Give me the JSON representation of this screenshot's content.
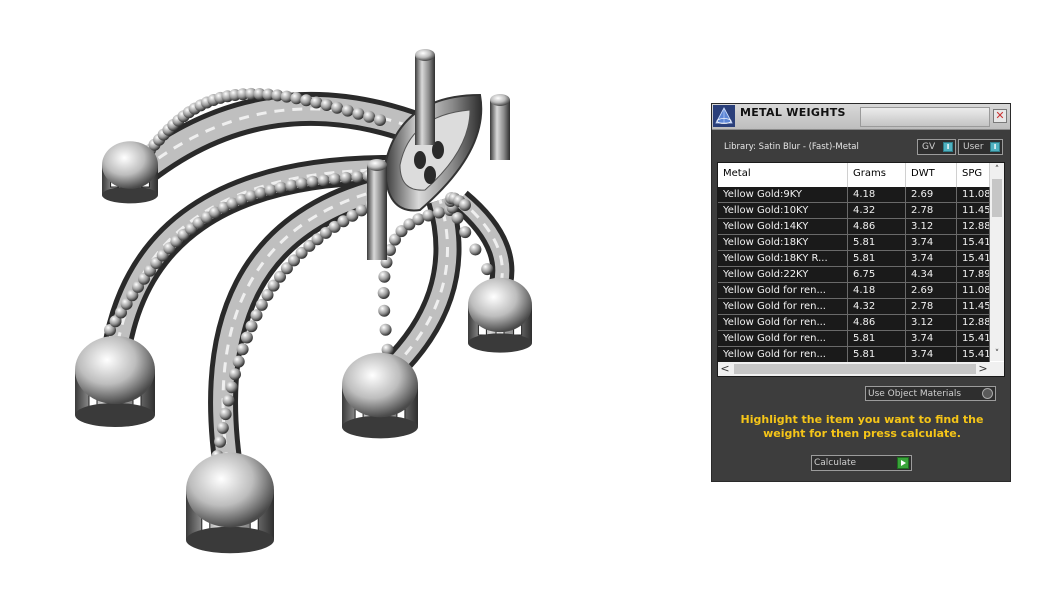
{
  "panel": {
    "title": "METAL WEIGHTS",
    "close_glyph": "✕",
    "library_label": "Library: Satin Blur - (Fast)-Metal",
    "toggles": [
      {
        "label": "GV",
        "glyph": "I"
      },
      {
        "label": "User",
        "glyph": "I"
      }
    ],
    "table": {
      "columns": [
        "Metal",
        "Grams",
        "DWT",
        "SPG"
      ],
      "rows": [
        [
          "Yellow Gold:9KY",
          "4.18",
          "2.69",
          "11.08"
        ],
        [
          "Yellow Gold:10KY",
          "4.32",
          "2.78",
          "11.45"
        ],
        [
          "Yellow Gold:14KY",
          "4.86",
          "3.12",
          "12.88"
        ],
        [
          "Yellow Gold:18KY",
          "5.81",
          "3.74",
          "15.41"
        ],
        [
          "Yellow Gold:18KY R...",
          "5.81",
          "3.74",
          "15.41"
        ],
        [
          "Yellow Gold:22KY",
          "6.75",
          "4.34",
          "17.89"
        ],
        [
          "Yellow Gold for ren...",
          "4.18",
          "2.69",
          "11.08"
        ],
        [
          "Yellow Gold for ren...",
          "4.32",
          "2.78",
          "11.45"
        ],
        [
          "Yellow Gold for ren...",
          "4.86",
          "3.12",
          "12.88"
        ],
        [
          "Yellow Gold for ren...",
          "5.81",
          "3.74",
          "15.41"
        ],
        [
          "Yellow Gold for ren...",
          "5.81",
          "3.74",
          "15.41"
        ]
      ],
      "scroll_up": "˄",
      "scroll_down": "˅",
      "scroll_left": "<",
      "scroll_right": ">"
    },
    "use_object_materials_label": "Use Object Materials",
    "hint": "Highlight the item you want to find the weight for then press calculate.",
    "calculate_label": "Calculate"
  },
  "colors": {
    "panel_bg": "#3d3d3d",
    "row_bg": "#1a1a1a",
    "hint": "#f5c518",
    "toggle_accent": "#4fb1c0",
    "calc_accent": "#39a43a"
  },
  "icons": [
    "metal-weights-logo-icon",
    "close-icon",
    "play-arrow-icon"
  ]
}
